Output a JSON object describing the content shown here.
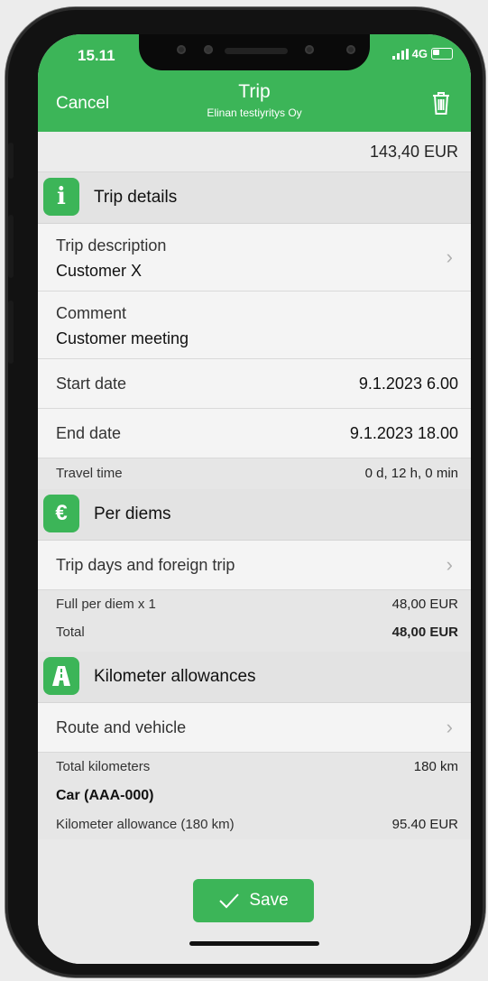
{
  "status": {
    "time": "15.11",
    "network": "4G"
  },
  "header": {
    "cancel": "Cancel",
    "title": "Trip",
    "subtitle": "Elinan testiyritys Oy",
    "delete_icon": "trash-icon"
  },
  "trip_total": "143,40 EUR",
  "sections": {
    "trip_details": {
      "icon": "i",
      "title": "Trip details",
      "description_label": "Trip description",
      "description_value": "Customer X",
      "comment_label": "Comment",
      "comment_value": "Customer meeting",
      "start_label": "Start date",
      "start_value": "9.1.2023 6.00",
      "end_label": "End date",
      "end_value": "9.1.2023 18.00",
      "travel_label": "Travel time",
      "travel_value": "0 d, 12 h, 0 min"
    },
    "per_diems": {
      "icon": "€",
      "title": "Per diems",
      "days_label": "Trip days and foreign trip",
      "full_label": "Full per diem x 1",
      "full_value": "48,00 EUR",
      "total_label": "Total",
      "total_value": "48,00 EUR"
    },
    "km": {
      "title": "Kilometer allowances",
      "route_label": "Route and vehicle",
      "total_km_label": "Total kilometers",
      "total_km_value": "180 km",
      "car": "Car (AAA-000)",
      "allowance_label": "Kilometer allowance (180 km)",
      "allowance_value": "95.40 EUR"
    }
  },
  "save_label": "Save",
  "colors": {
    "accent": "#3cb558"
  }
}
